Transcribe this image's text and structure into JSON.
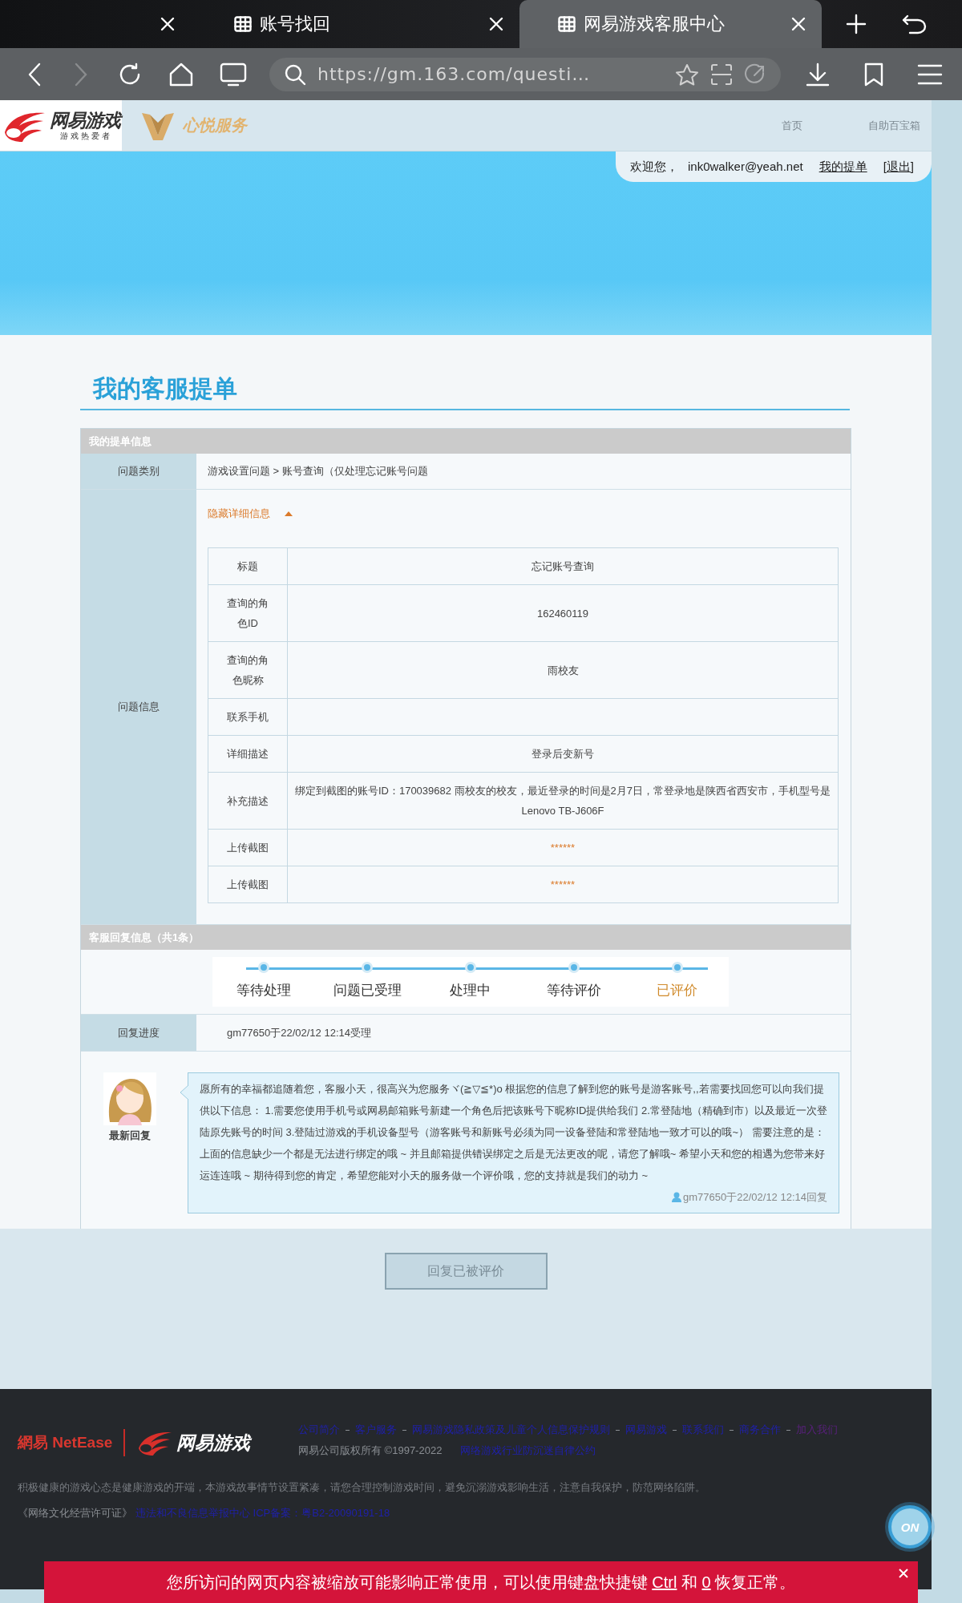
{
  "browser": {
    "tabs": [
      {
        "selected": false
      },
      {
        "title": "账号找回",
        "selected": false
      },
      {
        "title": "网易游戏客服中心",
        "selected": true
      }
    ],
    "address": "https://gm.163.com/questi…"
  },
  "site_header": {
    "logo_text": "网易游戏",
    "logo_subtext": "游 戏 热 爱 者",
    "service_logo": "心悦服务",
    "nav": [
      "首页",
      "自助百宝箱"
    ],
    "welcome": "欢迎您，",
    "user": "ink0walker@yeah.net",
    "my_tickets": "我的提单",
    "logout": "[退出]"
  },
  "page_title": "我的客服提单",
  "ticket": {
    "section_title": "我的提单信息",
    "category_label": "问题类别",
    "category": "游戏设置问题 > 账号查询（仅处理忘记账号问题",
    "info_label": "问题信息",
    "toggle": "隐藏详细信息",
    "expanded": true,
    "details": [
      {
        "label": "标题",
        "value": "忘记账号查询",
        "kind": "text"
      },
      {
        "label": "查询的角色ID",
        "value": "162460119",
        "kind": "text"
      },
      {
        "label": "查询的角色昵称",
        "value": "雨校友",
        "kind": "text"
      },
      {
        "label": "联系手机",
        "kind": "text"
      },
      {
        "label": "详细描述",
        "value": "登录后变新号",
        "kind": "text"
      },
      {
        "label": "补充描述",
        "value": "绑定到截图的账号ID：170039682 雨校友的校友，最近登录的时间是2月7日，常登录地是陕西省西安市，手机型号是Lenovo TB-J606F",
        "kind": "text"
      },
      {
        "label": "上传截图",
        "value": "******",
        "kind": "link"
      },
      {
        "label": "上传截图",
        "value": "******",
        "kind": "link"
      }
    ]
  },
  "reply": {
    "section_title": "客服回复信息（共1条）",
    "steps": [
      {
        "label": "等待处理",
        "current": false
      },
      {
        "label": "问题已受理",
        "current": false
      },
      {
        "label": "处理中",
        "current": false
      },
      {
        "label": "等待评价",
        "current": false
      },
      {
        "label": "已评价",
        "current": true
      }
    ],
    "progress_label": "回复进度",
    "progress": "gm77650于22/02/12 12:14受理",
    "avatar_caption": "最新回复",
    "message": "愿所有的幸福都追随着您，客服小天，很高兴为您服务ヾ(≧▽≦*)o 根据您的信息了解到您的账号是游客账号,,若需要找回您可以向我们提供以下信息： 1.需要您使用手机号或网易邮箱账号新建一个角色后把该账号下昵称ID提供给我们 2.常登陆地（精确到市）以及最近一次登陆原先账号的时间 3.登陆过游戏的手机设备型号（游客账号和新账号必须为同一设备登陆和常登陆地一致才可以的哦~） 需要注意的是：上面的信息缺少一个都是无法进行绑定的哦 ~ 并且邮箱提供错误绑定之后是无法更改的呢，请您了解哦~ 希望小天和您的相遇为您带来好运连连哦 ~ 期待得到您的肯定，希望您能对小天的服务做一个评价哦，您的支持就是我们的动力 ~",
    "signature": "gm77650于22/02/12 12:14回复"
  },
  "button": {
    "label": "回复已被评价",
    "disabled": true
  },
  "footer": {
    "netease_logo": "網易 NetEase",
    "game_logo": "网易游戏",
    "links": [
      {
        "text": "公司简介",
        "visited": false
      },
      {
        "text": "客户服务",
        "visited": false
      },
      {
        "text": "网易游戏隐私政策及儿童个人信息保护规则",
        "visited": false
      },
      {
        "text": "网易游戏",
        "visited": false
      },
      {
        "text": "联系我们",
        "visited": false
      },
      {
        "text": "商务合作",
        "visited": false
      },
      {
        "text": "加入我们",
        "visited": true
      }
    ],
    "copyright": "网易公司版权所有 ©1997-2022",
    "pledge_link": "网络游戏行业防沉迷自律公约",
    "health_notice": "积极健康的游戏心态是健康游戏的开端，本游戏故事情节设置紧凑，请您合理控制游戏时间，避免沉溺游戏影响生活，注意自我保护，防范网络陷阱。",
    "license": "《网络文化经营许可证》",
    "report_link": "违法和不良信息举报中心 ICP备案：粤B2-20090191-18"
  },
  "notice": {
    "parts": [
      {
        "text": "您所访问的网页内容被缩放可能影响正常使用，可以使用键盘快捷键 ",
        "key": false
      },
      {
        "text": "Ctrl",
        "key": true
      },
      {
        "text": " 和 ",
        "key": false
      },
      {
        "text": "0",
        "key": true
      },
      {
        "text": " 恢复正常。",
        "key": false
      }
    ]
  },
  "on_badge": "ON"
}
